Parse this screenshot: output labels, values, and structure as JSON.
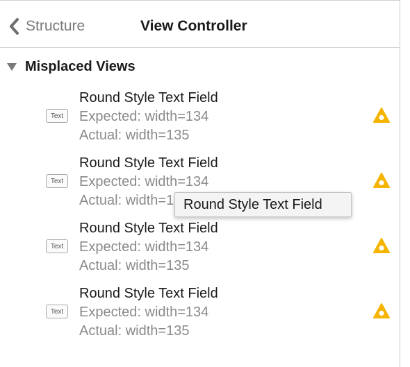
{
  "navbar": {
    "back_label": "Structure",
    "title": "View Controller"
  },
  "section": {
    "title": "Misplaced Views"
  },
  "items": [
    {
      "badge": "Text",
      "title": "Round Style Text Field",
      "expected": "Expected: width=134",
      "actual": "Actual: width=135"
    },
    {
      "badge": "Text",
      "title": "Round Style Text Field",
      "expected": "Expected: width=134",
      "actual": "Actual: width=135"
    },
    {
      "badge": "Text",
      "title": "Round Style Text Field",
      "expected": "Expected: width=134",
      "actual": "Actual: width=135"
    },
    {
      "badge": "Text",
      "title": "Round Style Text Field",
      "expected": "Expected: width=134",
      "actual": "Actual: width=135"
    }
  ],
  "tooltip": {
    "text": "Round Style Text Field"
  },
  "colors": {
    "warning": "#f5b400",
    "secondary_text": "#8a8a8a"
  },
  "icons": {
    "back": "chevron-left-icon",
    "disclosure": "disclosure-triangle-down-icon",
    "warning": "warning-triangle-icon"
  }
}
